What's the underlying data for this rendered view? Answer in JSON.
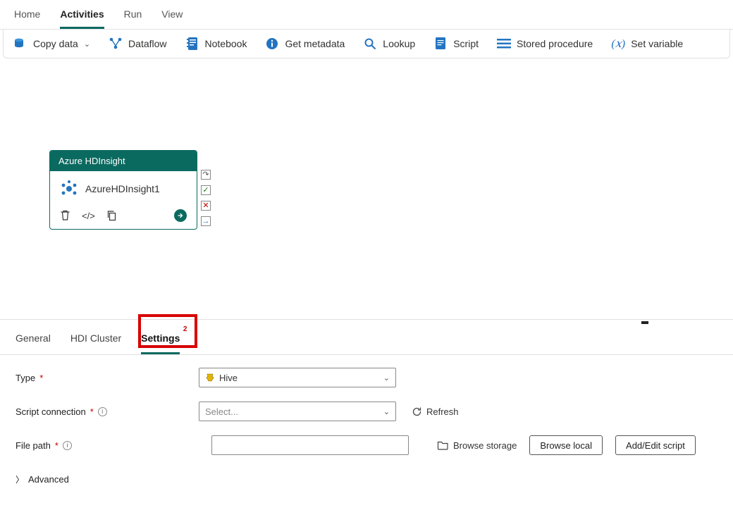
{
  "menu": {
    "home": "Home",
    "activities": "Activities",
    "run": "Run",
    "view": "View"
  },
  "toolbar": {
    "copy_data": "Copy data",
    "dataflow": "Dataflow",
    "notebook": "Notebook",
    "get_metadata": "Get metadata",
    "lookup": "Lookup",
    "script": "Script",
    "stored_procedure": "Stored procedure",
    "set_variable": "Set variable"
  },
  "activity": {
    "type_title": "Azure HDInsight",
    "name": "AzureHDInsight1"
  },
  "props_tabs": {
    "general": "General",
    "hdi_cluster": "HDI Cluster",
    "settings": "Settings",
    "settings_badge": "2"
  },
  "form": {
    "type_label": "Type",
    "type_value": "Hive",
    "script_conn_label": "Script connection",
    "script_conn_placeholder": "Select...",
    "refresh": "Refresh",
    "file_path_label": "File path",
    "file_path_value": "",
    "browse_storage": "Browse storage",
    "browse_local": "Browse local",
    "add_edit_script": "Add/Edit script",
    "advanced": "Advanced"
  }
}
